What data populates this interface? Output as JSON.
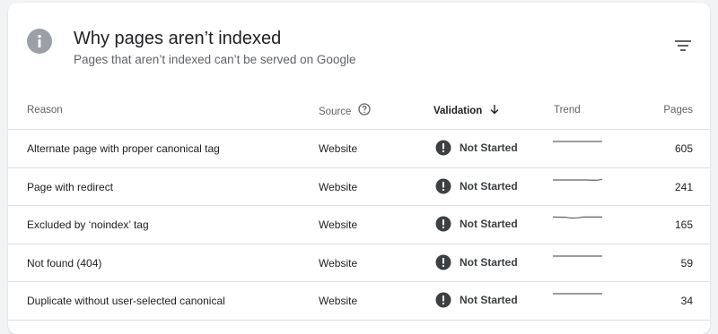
{
  "header": {
    "title": "Why pages aren’t indexed",
    "subtitle": "Pages that aren’t indexed can’t be served on Google"
  },
  "table": {
    "columns": {
      "reason": "Reason",
      "source": "Source",
      "validation": "Validation",
      "trend": "Trend",
      "pages": "Pages"
    },
    "rows": [
      {
        "reason": "Alternate page with proper canonical tag",
        "source": "Website",
        "validation": "Not Started",
        "pages": "605"
      },
      {
        "reason": "Page with redirect",
        "source": "Website",
        "validation": "Not Started",
        "pages": "241"
      },
      {
        "reason": "Excluded by ‘noindex’ tag",
        "source": "Website",
        "validation": "Not Started",
        "pages": "165"
      },
      {
        "reason": "Not found (404)",
        "source": "Website",
        "validation": "Not Started",
        "pages": "59"
      },
      {
        "reason": "Duplicate without user-selected canonical",
        "source": "Website",
        "validation": "Not Started",
        "pages": "34"
      }
    ]
  },
  "colors": {
    "accent_text": "#202124",
    "secondary_text": "#5f6368",
    "info_icon": "#9aa0a6",
    "status_icon": "#3c4043",
    "trend_line": "#5f6368"
  },
  "icons": {
    "header": "info-icon",
    "filter": "filter-icon",
    "source_help": "help-circle-icon",
    "sort": "arrow-down-icon",
    "status": "exclamation-circle-icon"
  }
}
